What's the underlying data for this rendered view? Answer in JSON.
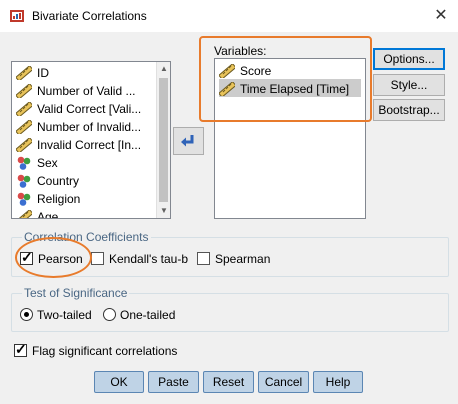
{
  "window": {
    "title": "Bivariate Correlations",
    "close_glyph": "✕"
  },
  "source_list": {
    "items": [
      {
        "label": "ID",
        "icon": "ruler-icon"
      },
      {
        "label": "Number of Valid ...",
        "icon": "ruler-icon"
      },
      {
        "label": "Valid Correct [Vali...",
        "icon": "ruler-icon"
      },
      {
        "label": "Number of Invalid...",
        "icon": "ruler-icon"
      },
      {
        "label": "Invalid Correct [In...",
        "icon": "ruler-icon"
      },
      {
        "label": "Sex",
        "icon": "nominal-icon"
      },
      {
        "label": "Country",
        "icon": "nominal-icon"
      },
      {
        "label": "Religion",
        "icon": "nominal-icon"
      },
      {
        "label": "Age",
        "icon": "ruler-icon"
      }
    ]
  },
  "variables": {
    "label": "Variables:",
    "items": [
      {
        "label": "Score",
        "icon": "ruler-icon"
      },
      {
        "label": "Time Elapsed [Time]",
        "icon": "ruler-icon",
        "selected": true
      }
    ]
  },
  "side_buttons": {
    "options": "Options...",
    "style": "Style...",
    "bootstrap": "Bootstrap..."
  },
  "correlation": {
    "title": "Correlation Coefficients",
    "pearson": {
      "label": "Pearson",
      "checked": true
    },
    "kendall": {
      "label": "Kendall's tau-b",
      "checked": false
    },
    "spearman": {
      "label": "Spearman",
      "checked": false
    }
  },
  "significance": {
    "title": "Test of Significance",
    "two_tailed": {
      "label": "Two-tailed",
      "selected": true
    },
    "one_tailed": {
      "label": "One-tailed",
      "selected": false
    }
  },
  "flag": {
    "label": "Flag significant correlations",
    "checked": true
  },
  "bottom_buttons": {
    "ok": "OK",
    "paste": "Paste",
    "reset": "Reset",
    "cancel": "Cancel",
    "help": "Help"
  },
  "colors": {
    "annotation": "#e87b2c",
    "group_title": "#4a6784",
    "bottom_button_bg": "#bfd3e6"
  }
}
